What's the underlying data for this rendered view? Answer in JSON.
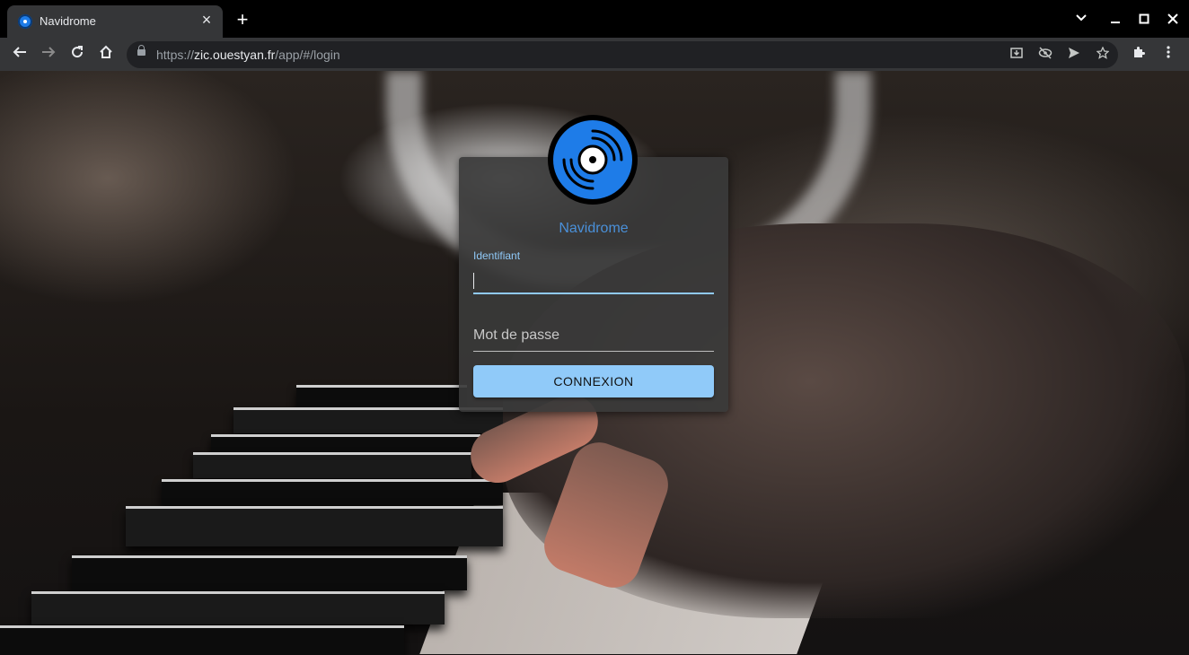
{
  "browser": {
    "tab": {
      "title": "Navidrome",
      "favicon": "navidrome-record-icon"
    },
    "new_tab_icon": "plus-icon",
    "url": {
      "scheme": "https://",
      "host": "zic.ouestyan.fr",
      "path": "/app/#/login"
    },
    "toolbar_icons": [
      "back-icon",
      "forward-icon",
      "reload-icon",
      "home-icon",
      "install-icon",
      "eye-off-icon",
      "send-icon",
      "star-icon",
      "puzzle-icon",
      "menu-icon"
    ],
    "window_controls": [
      "chevron-down-icon",
      "minimize-icon",
      "maximize-icon",
      "close-icon"
    ]
  },
  "login": {
    "app_name": "Navidrome",
    "username_label": "Identifiant",
    "username_value": "",
    "password_placeholder": "Mot de passe",
    "submit_label": "CONNEXION",
    "accent_color": "#90caf9",
    "logo_color": "#1e7ce8"
  }
}
